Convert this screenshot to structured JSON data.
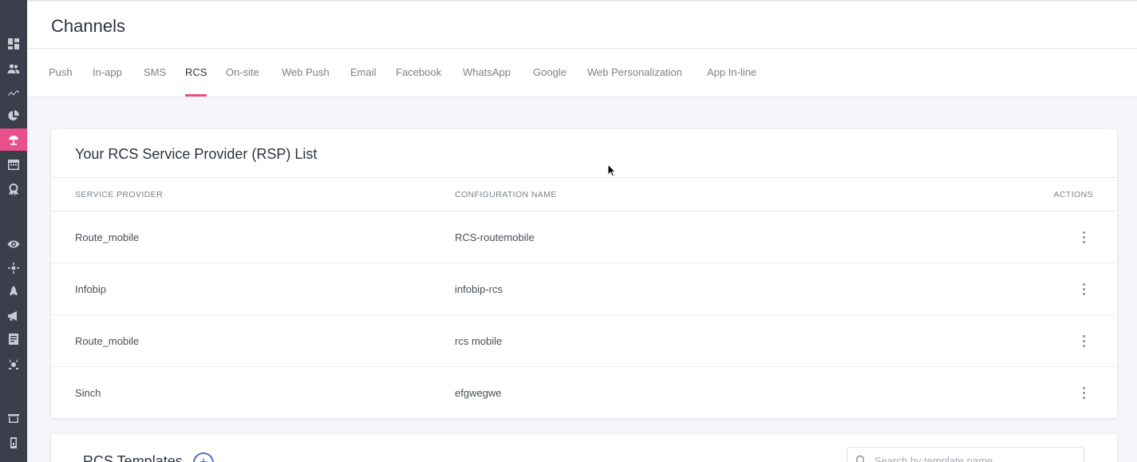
{
  "page": {
    "title": "Channels"
  },
  "colors": {
    "accent": "#e7508a",
    "sidebar": "#3a3f4b",
    "link": "#5a6ad0"
  },
  "sidebar": {
    "items": [
      {
        "icon": "dashboard-icon",
        "active": false
      },
      {
        "icon": "users-icon",
        "active": false
      },
      {
        "icon": "trend-icon",
        "active": false
      },
      {
        "icon": "pie-chart-icon",
        "active": false
      },
      {
        "icon": "channels-icon",
        "active": true
      },
      {
        "icon": "calendar-icon",
        "active": false
      },
      {
        "icon": "badge-icon",
        "active": false
      },
      {
        "icon": "eye-icon",
        "active": false
      },
      {
        "icon": "settings-icon",
        "active": false
      },
      {
        "icon": "rocket-icon",
        "active": false
      },
      {
        "icon": "megaphone-icon",
        "active": false
      },
      {
        "icon": "document-icon",
        "active": false
      },
      {
        "icon": "gear-icon",
        "active": false
      },
      {
        "icon": "store-icon",
        "active": false
      },
      {
        "icon": "mobile-icon",
        "active": false
      }
    ]
  },
  "tabs": [
    {
      "label": "Push",
      "active": false
    },
    {
      "label": "In-app",
      "active": false
    },
    {
      "label": "SMS",
      "active": false
    },
    {
      "label": "RCS",
      "active": true
    },
    {
      "label": "On-site",
      "active": false
    },
    {
      "label": "Web Push",
      "active": false
    },
    {
      "label": "Email",
      "active": false
    },
    {
      "label": "Facebook",
      "active": false
    },
    {
      "label": "WhatsApp",
      "active": false
    },
    {
      "label": "Google",
      "active": false
    },
    {
      "label": "Web Personalization",
      "active": false
    },
    {
      "label": "App In-line",
      "active": false
    }
  ],
  "rsp": {
    "title": "Your RCS Service Provider (RSP) List",
    "columns": {
      "provider": "SERVICE PROVIDER",
      "config": "CONFIGURATION NAME",
      "actions": "ACTIONS"
    },
    "rows": [
      {
        "provider": "Route_mobile",
        "config": "RCS-routemobile"
      },
      {
        "provider": "Infobip",
        "config": "infobip-rcs"
      },
      {
        "provider": "Route_mobile",
        "config": "rcs mobile"
      },
      {
        "provider": "Sinch",
        "config": "efgwegwe"
      }
    ]
  },
  "templates": {
    "title": "RCS Templates",
    "search_placeholder": "Search by template name"
  }
}
